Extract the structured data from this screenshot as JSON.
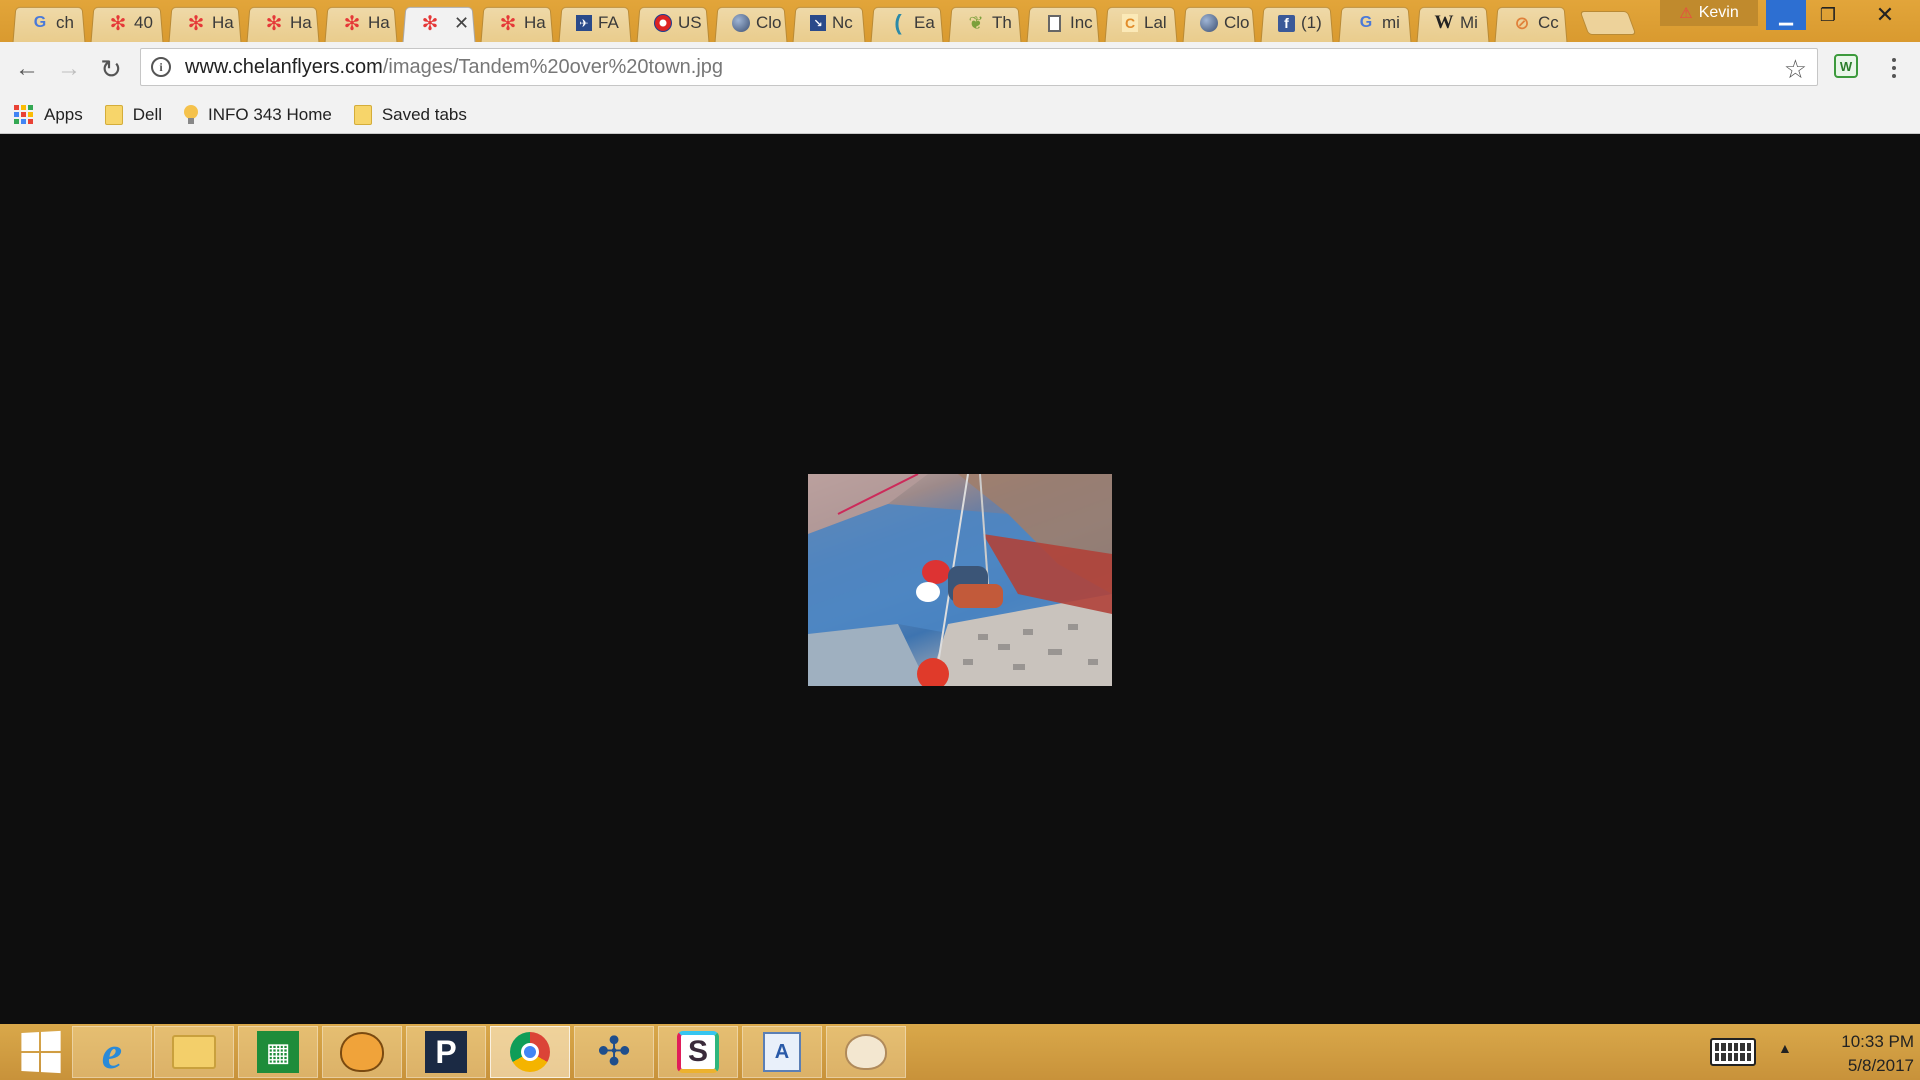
{
  "browser": {
    "tabs": [
      {
        "favicon": "google-icon",
        "title": "ch",
        "active": false
      },
      {
        "favicon": "flower-icon",
        "title": "40",
        "active": false
      },
      {
        "favicon": "flower-icon",
        "title": "Ha",
        "active": false
      },
      {
        "favicon": "flower-icon",
        "title": "Ha",
        "active": false
      },
      {
        "favicon": "flower-icon",
        "title": "Ha",
        "active": false
      },
      {
        "favicon": "flower-icon",
        "title": "",
        "active": true
      },
      {
        "favicon": "flower-icon",
        "title": "Ha",
        "active": false
      },
      {
        "favicon": "fa-icon",
        "title": "FA",
        "active": false
      },
      {
        "favicon": "us-icon",
        "title": "US",
        "active": false
      },
      {
        "favicon": "globe-icon",
        "title": "Clo",
        "active": false
      },
      {
        "favicon": "nc-icon",
        "title": "Nc",
        "active": false
      },
      {
        "favicon": "curl-icon",
        "title": "Ea",
        "active": false
      },
      {
        "favicon": "leaf-icon",
        "title": "Th",
        "active": false
      },
      {
        "favicon": "document-icon",
        "title": "Inc",
        "active": false
      },
      {
        "favicon": "c-icon",
        "title": "Lal",
        "active": false
      },
      {
        "favicon": "globe-icon",
        "title": "Clo",
        "active": false
      },
      {
        "favicon": "facebook-icon",
        "title": "(1)",
        "active": false
      },
      {
        "favicon": "google-icon",
        "title": "mi",
        "active": false
      },
      {
        "favicon": "wikipedia-icon",
        "title": "Mi",
        "active": false
      },
      {
        "favicon": "ring-icon",
        "title": "Cc",
        "active": false
      }
    ],
    "profile_name": "Kevin",
    "url_host": "www.chelanflyers.com",
    "url_path": "/images/Tandem%20over%20town.jpg",
    "bookmarks": [
      {
        "icon": "apps-icon",
        "label": "Apps"
      },
      {
        "icon": "folder-icon",
        "label": "Dell"
      },
      {
        "icon": "lightbulb-icon",
        "label": "INFO 343 Home"
      },
      {
        "icon": "folder-icon",
        "label": "Saved tabs"
      }
    ]
  },
  "taskbar": {
    "apps": [
      {
        "name": "start",
        "icon": "windows-icon"
      },
      {
        "name": "internet-explorer",
        "icon": "internet-explorer-icon"
      },
      {
        "name": "file-explorer",
        "icon": "file-explorer-icon"
      },
      {
        "name": "store",
        "icon": "store-icon"
      },
      {
        "name": "scratch",
        "icon": "scratch-cat-icon"
      },
      {
        "name": "pandora",
        "icon": "pandora-icon"
      },
      {
        "name": "chrome",
        "icon": "chrome-icon"
      },
      {
        "name": "tableau",
        "icon": "tableau-icon"
      },
      {
        "name": "slack",
        "icon": "slack-icon"
      },
      {
        "name": "wordpad",
        "icon": "wordpad-icon"
      },
      {
        "name": "paint",
        "icon": "paint-icon"
      }
    ],
    "clock_time": "10:33 PM",
    "clock_date": "5/8/2017"
  },
  "colors": {
    "titlebar": "#e2a53a",
    "page_background": "#0e0e0e",
    "taskbar": "#d9a84a",
    "minimize_button": "#2d6fd2"
  }
}
